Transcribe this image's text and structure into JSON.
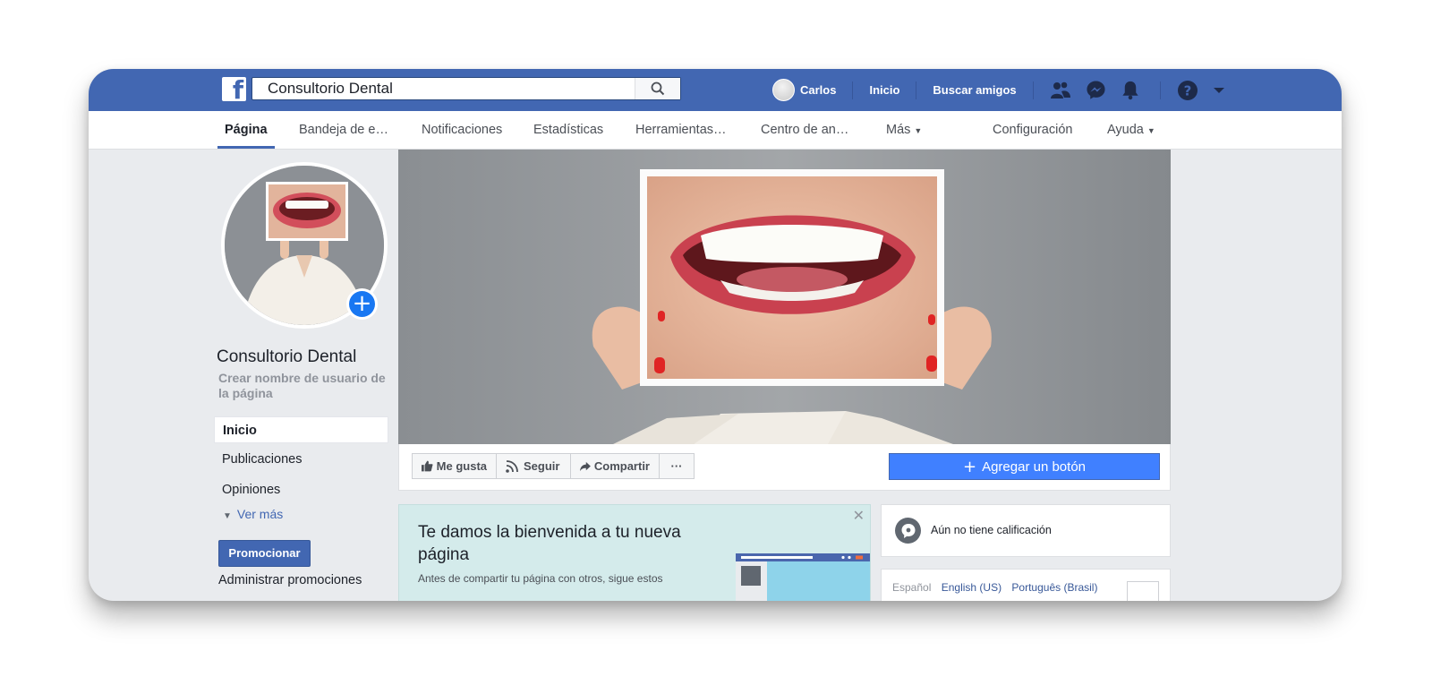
{
  "topbar": {
    "search_value": "Consultorio Dental",
    "user_name": "Carlos",
    "home_label": "Inicio",
    "find_friends_label": "Buscar amigos"
  },
  "nav": {
    "tabs": [
      "Página",
      "Bandeja de e…",
      "Notificaciones",
      "Estadísticas",
      "Herramientas…",
      "Centro de an…",
      "Más",
      "Configuración",
      "Ayuda"
    ]
  },
  "sidebar": {
    "page_name": "Consultorio Dental",
    "username_prompt": "Crear nombre de usuario de la página",
    "items": [
      "Inicio",
      "Publicaciones",
      "Opiniones"
    ],
    "see_more": "Ver más",
    "promote_label": "Promocionar",
    "manage_promotions": "Administrar promociones"
  },
  "actions": {
    "like_label": "Me gusta",
    "follow_label": "Seguir",
    "share_label": "Compartir",
    "more_label": "···",
    "add_button_label": "Agregar un botón"
  },
  "welcome": {
    "title": "Te damos la bienvenida a tu nueva página",
    "text": "Antes de compartir tu página con otros, sigue estos"
  },
  "rating": {
    "text": "Aún no tiene calificación"
  },
  "languages": [
    "Español",
    "English (US)",
    "Português (Brasil)"
  ],
  "colors": {
    "fb_blue": "#4267b2",
    "button_blue": "#4080ff",
    "page_bg": "#e9ebee"
  }
}
